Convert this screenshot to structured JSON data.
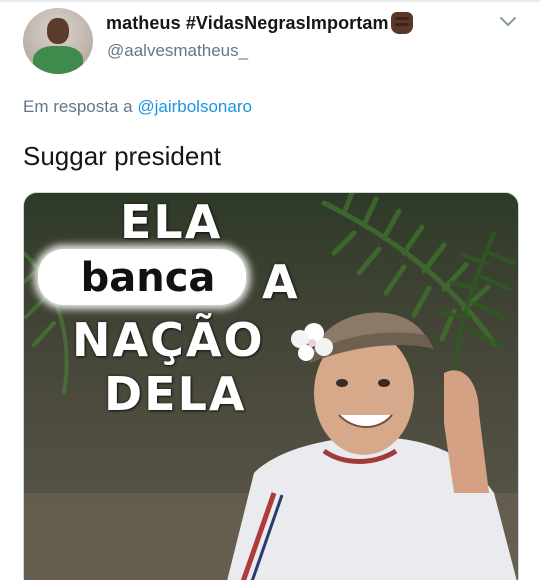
{
  "tweet": {
    "display_name": "matheus #VidasNegrasImportam",
    "handle": "@aalvesmatheus_",
    "reply_prefix": "Em resposta a",
    "reply_mention": "@jairbolsonaro",
    "text": "Suggar president"
  },
  "media": {
    "meme_lines": [
      "ELA",
      "banca",
      "A",
      "NAÇÃO",
      "DELA"
    ]
  },
  "icons": {
    "avatar": "profile-photo",
    "caret": "chevron-down-icon",
    "emoji": "raised-fist-dark-skin-tone-emoji"
  },
  "colors": {
    "text_primary": "#14171a",
    "text_secondary": "#657786",
    "link": "#1b95e0"
  }
}
